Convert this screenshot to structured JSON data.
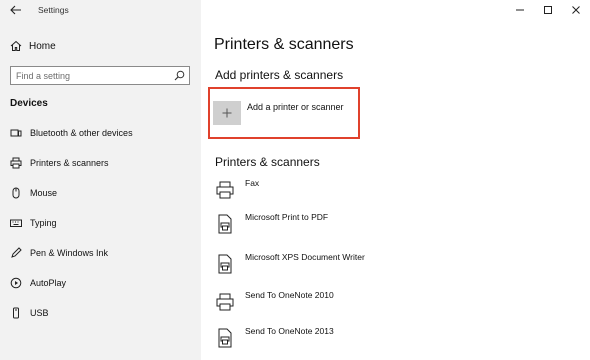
{
  "window": {
    "title": "Settings"
  },
  "sidebar": {
    "home_label": "Home",
    "search_placeholder": "Find a setting",
    "section_label": "Devices",
    "items": [
      {
        "label": "Bluetooth & other devices",
        "icon": "bluetooth-devices-icon"
      },
      {
        "label": "Printers & scanners",
        "icon": "printer-icon"
      },
      {
        "label": "Mouse",
        "icon": "mouse-icon"
      },
      {
        "label": "Typing",
        "icon": "keyboard-icon"
      },
      {
        "label": "Pen & Windows Ink",
        "icon": "pen-icon"
      },
      {
        "label": "AutoPlay",
        "icon": "autoplay-icon"
      },
      {
        "label": "USB",
        "icon": "usb-icon"
      }
    ]
  },
  "main": {
    "title": "Printers & scanners",
    "add_section_heading": "Add printers & scanners",
    "add_button_label": "Add a printer or scanner",
    "list_heading": "Printers & scanners",
    "printers": [
      {
        "name": "Fax",
        "icon": "fax-printer-icon"
      },
      {
        "name": "Microsoft Print to PDF",
        "icon": "document-printer-icon"
      },
      {
        "name": "Microsoft XPS Document Writer",
        "icon": "document-printer-icon"
      },
      {
        "name": "Send To OneNote 2010",
        "icon": "printer-icon"
      },
      {
        "name": "Send To OneNote 2013",
        "icon": "document-printer-icon"
      }
    ]
  },
  "colors": {
    "sidebar_bg": "#f2f2f2",
    "highlight_border": "#e0412c",
    "add_tile": "#cfcfcf"
  }
}
